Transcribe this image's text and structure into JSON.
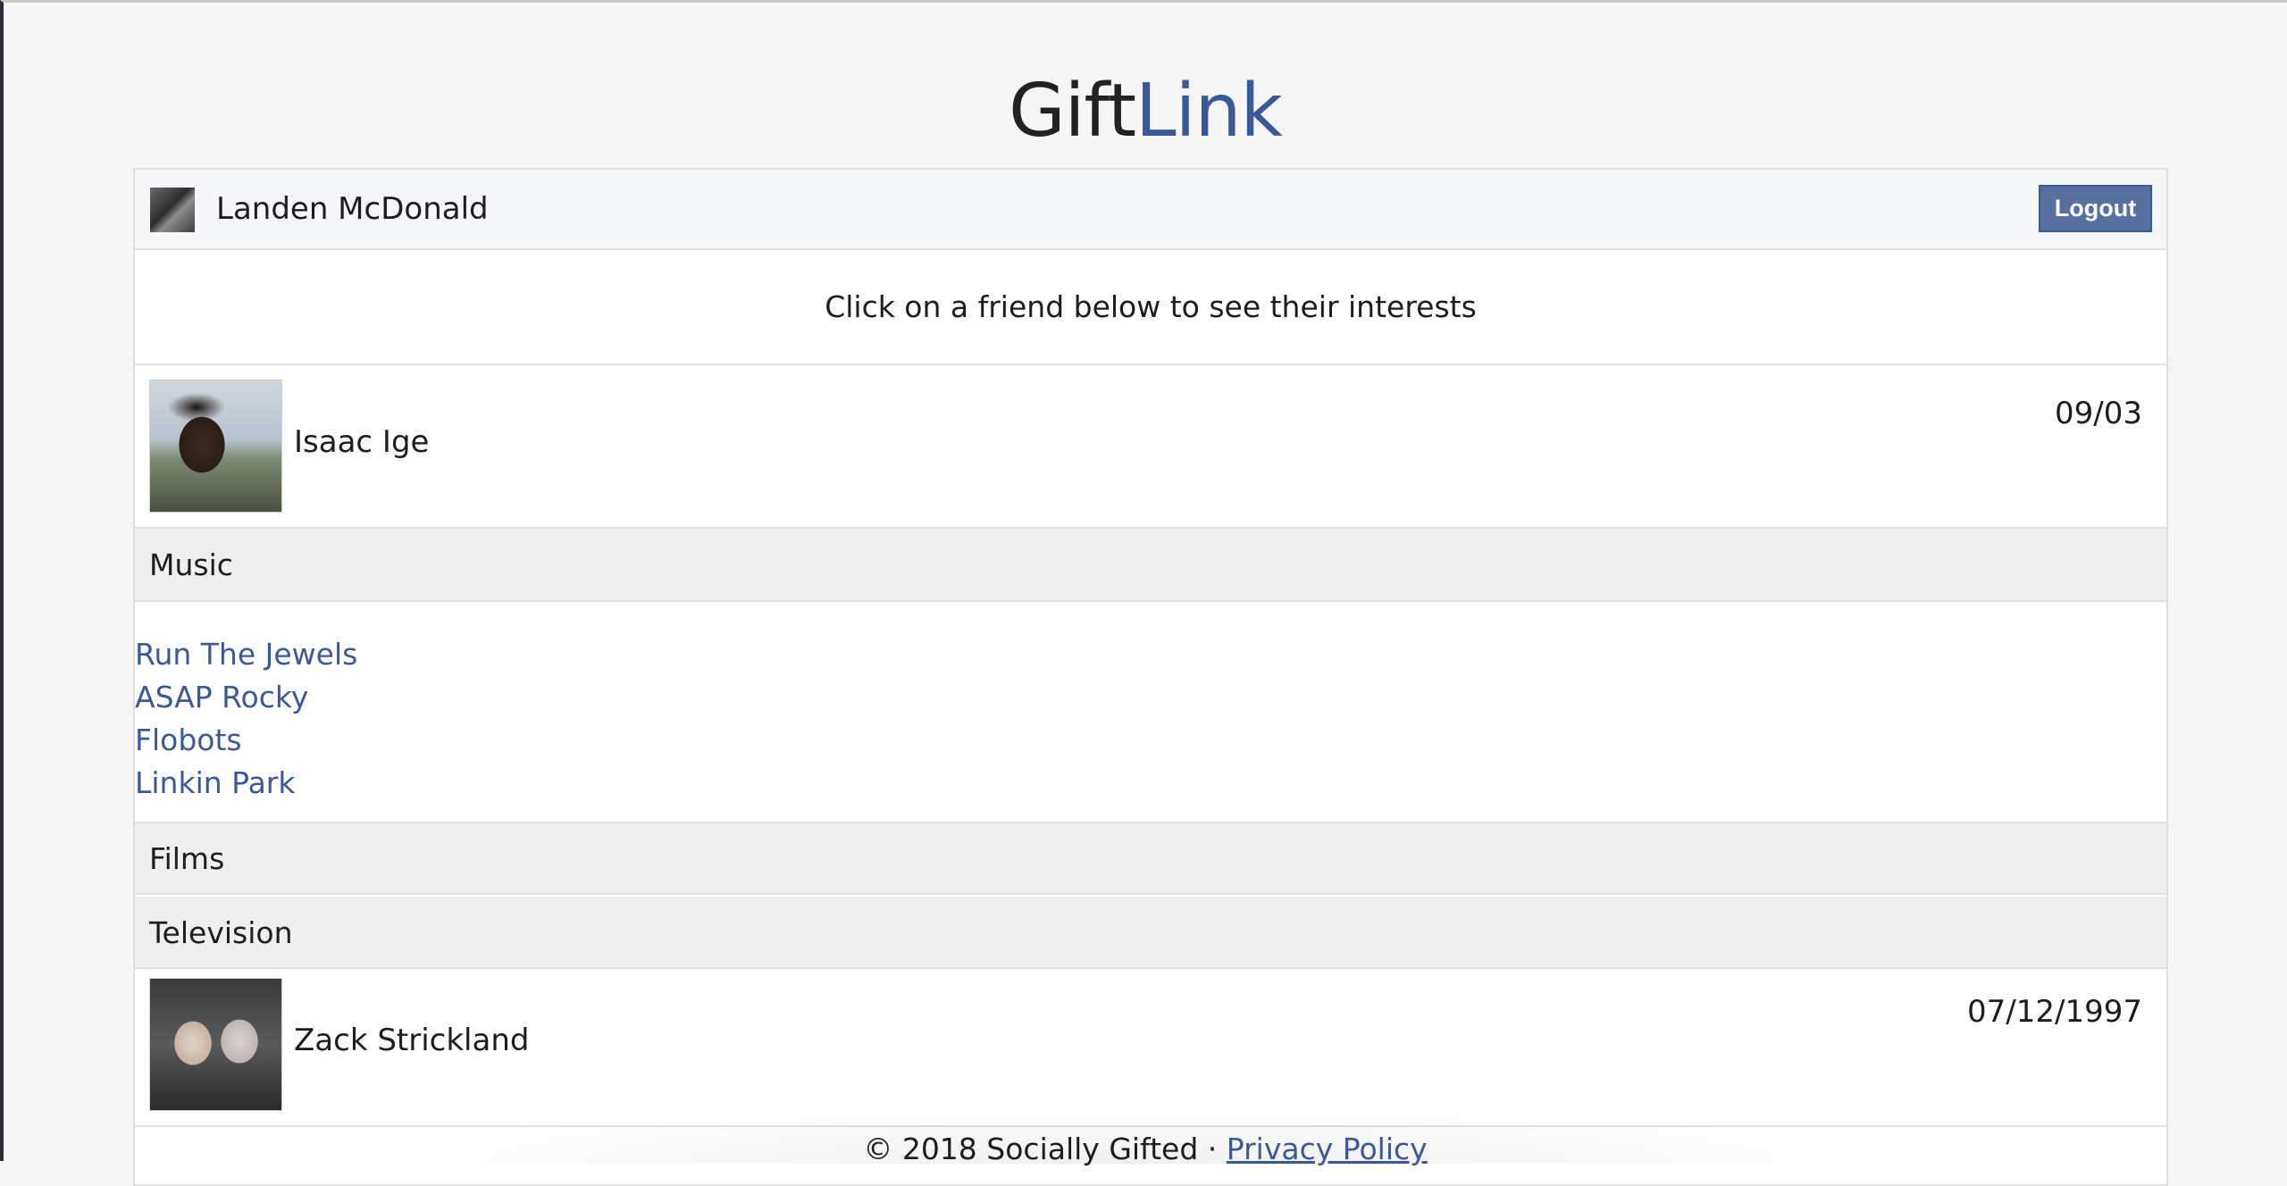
{
  "brand": {
    "part1": "Gift",
    "part2": "Link"
  },
  "header": {
    "user_name": "Landen McDonald",
    "logout_label": "Logout"
  },
  "prompt": "Click on a friend below to see their interests",
  "friends": [
    {
      "name": "Isaac Ige",
      "date": "09/03",
      "sections": [
        {
          "title": "Music",
          "items": [
            "Run The Jewels",
            "ASAP Rocky",
            "Flobots",
            "Linkin Park"
          ]
        },
        {
          "title": "Films",
          "items": []
        },
        {
          "title": "Television",
          "items": []
        }
      ]
    },
    {
      "name": "Zack Strickland",
      "date": "07/12/1997"
    }
  ],
  "footer": {
    "copyright": "© 2018 Socially Gifted · ",
    "privacy_label": "Privacy Policy"
  },
  "colors": {
    "accent": "#3b5998",
    "button": "#56709f"
  }
}
